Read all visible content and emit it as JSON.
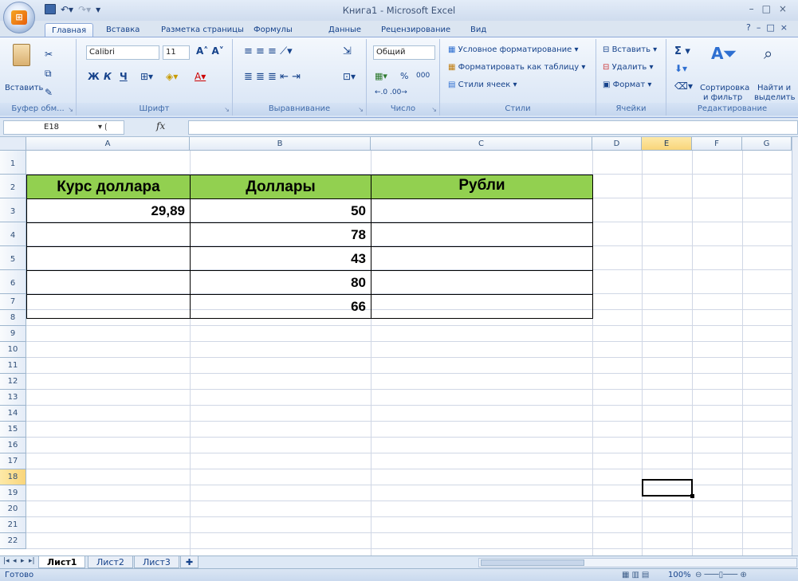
{
  "window": {
    "title": "Книга1 - Microsoft Excel"
  },
  "tabs": [
    "Главная",
    "Вставка",
    "Разметка страницы",
    "Формулы",
    "Данные",
    "Рецензирование",
    "Вид"
  ],
  "ribbon": {
    "clipboard": {
      "paste": "Вставить",
      "label": "Буфер обм..."
    },
    "font": {
      "name": "Calibri",
      "size": "11",
      "label": "Шрифт"
    },
    "alignment": {
      "label": "Выравнивание"
    },
    "number": {
      "format": "Общий",
      "percent": "%",
      "thousands": "000",
      "label": "Число"
    },
    "styles": {
      "conditional": "Условное форматирование",
      "as_table": "Форматировать как таблицу",
      "cell_styles": "Стили ячеек",
      "label": "Стили"
    },
    "cells": {
      "insert": "Вставить",
      "delete": "Удалить",
      "format": "Формат",
      "label": "Ячейки"
    },
    "editing": {
      "sort1": "Сортировка",
      "sort2": "и фильтр",
      "find1": "Найти и",
      "find2": "выделить",
      "label": "Редактирование"
    }
  },
  "formula_bar": {
    "name_box": "E18",
    "fx": "fx",
    "value": ""
  },
  "columns": [
    "A",
    "B",
    "C",
    "D",
    "E",
    "F",
    "G"
  ],
  "rows": [
    "1",
    "2",
    "3",
    "4",
    "5",
    "6",
    "7",
    "8",
    "9",
    "10",
    "11",
    "12",
    "13",
    "14",
    "15",
    "16",
    "17",
    "18",
    "19",
    "20",
    "21",
    "22"
  ],
  "headers": {
    "a1": "Курс доллара",
    "b1": "Доллары",
    "c1": "Рубли"
  },
  "cells": {
    "a2": "29,89",
    "b": [
      "50",
      "78",
      "43",
      "80",
      "66"
    ]
  },
  "sheets": [
    "Лист1",
    "Лист2",
    "Лист3"
  ],
  "status": {
    "ready": "Готово",
    "zoom": "100%"
  },
  "colors": {
    "header_fill": "#92d050",
    "selected_header": "#f9d57a"
  }
}
